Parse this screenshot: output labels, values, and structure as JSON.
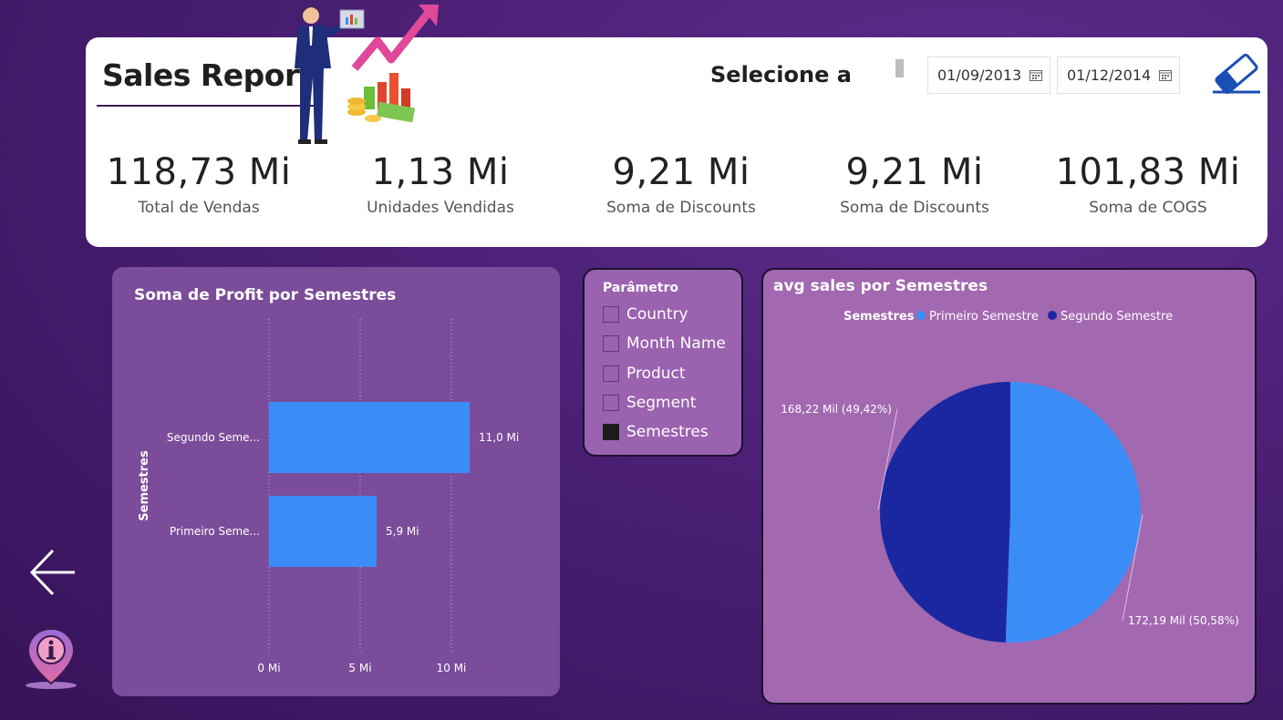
{
  "header": {
    "title": "Sales Report",
    "select_label": "Selecione a",
    "date_start": "01/09/2013",
    "date_end": "01/12/2014"
  },
  "kpis": [
    {
      "value": "118,73 Mi",
      "label": "Total de Vendas"
    },
    {
      "value": "1,13 Mi",
      "label": "Unidades Vendidas"
    },
    {
      "value": "9,21 Mi",
      "label": "Soma de Discounts"
    },
    {
      "value": "9,21 Mi",
      "label": "Soma de Discounts"
    },
    {
      "value": "101,83 Mi",
      "label": "Soma de COGS"
    }
  ],
  "profit_chart": {
    "title": "Soma de Profit por Semestres"
  },
  "parameter": {
    "title": "Parâmetro",
    "items": [
      {
        "label": "Country",
        "checked": false
      },
      {
        "label": "Month Name",
        "checked": false
      },
      {
        "label": "Product",
        "checked": false
      },
      {
        "label": "Segment",
        "checked": false
      },
      {
        "label": "Semestres",
        "checked": true
      }
    ]
  },
  "avg_chart": {
    "title": "avg sales por Semestres"
  },
  "icons": {
    "back": "arrow-left-icon",
    "info": "info-pin-icon",
    "eraser": "eraser-icon",
    "calendar": "calendar-icon"
  },
  "colors": {
    "bar": "#3a8df7",
    "pie_primeiro": "#3a8df7",
    "pie_segundo": "#1a27a0"
  },
  "chart_data": [
    {
      "type": "bar",
      "orientation": "horizontal",
      "title": "Soma de Profit por Semestres",
      "ylabel": "Semestres",
      "xlabel": "",
      "categories": [
        "Segundo Seme...",
        "Primeiro Seme..."
      ],
      "values": [
        11.0,
        5.9
      ],
      "data_labels": [
        "11,0 Mi",
        "5,9 Mi"
      ],
      "xticks": [
        "0 Mi",
        "5 Mi",
        "10 Mi"
      ],
      "xlim": [
        0,
        13
      ],
      "grid": true
    },
    {
      "type": "pie",
      "title": "avg sales por Semestres",
      "legend_title": "Semestres",
      "legend_position": "top",
      "categories": [
        "Primeiro Semestre",
        "Segundo Semestre"
      ],
      "values": [
        172.19,
        168.22
      ],
      "data_labels": [
        "172,19 Mil (50,58%)",
        "168,22 Mil (49,42%)"
      ]
    }
  ]
}
